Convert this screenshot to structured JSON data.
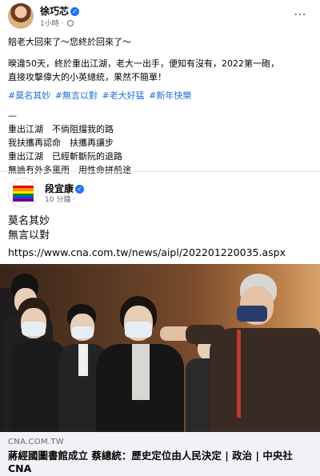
{
  "post": {
    "author": "徐巧芯",
    "time": "1小時",
    "more_icon": "⋯",
    "line1": "賠老大回來了～您終於回來了～",
    "line2": "暌違50天，終於重出江湖，老大一出手，便知有沒有，2022第一砲，\n直接攻擊偉大的小英總統，果然不簡單！",
    "hashtags": [
      "#莫名其妙",
      "#無言以對",
      "#老大好猛",
      "#新年快樂"
    ],
    "poem": "—\n重出江湖　不倘阻擋我的路\n我扶攜再認命　扶攜再讓步\n重出江湖　已經斬斷阮的退路\n無論有外多風雨　用性命拼前途"
  },
  "shared": {
    "author": "段宜康",
    "time": "10 分鐘",
    "line1": "莫名其妙",
    "line2": "無言以對",
    "url": "https://www.cna.com.tw/news/aipl/202201220035.aspx",
    "domain": "CNA.COM.TW",
    "link_title": "蔣經國圖書館成立 蔡總統：歷史定位由人民決定 | 政治 | 中央社 CNA"
  },
  "colors": {
    "link_blue": "#216fdb",
    "verified_blue": "#1877f2",
    "meta_gray": "#65676b",
    "footer_bg": "#f0f2f5"
  },
  "icons": {
    "verified": "verified-badge-icon",
    "globe": "globe-icon",
    "more": "more-options-icon"
  }
}
